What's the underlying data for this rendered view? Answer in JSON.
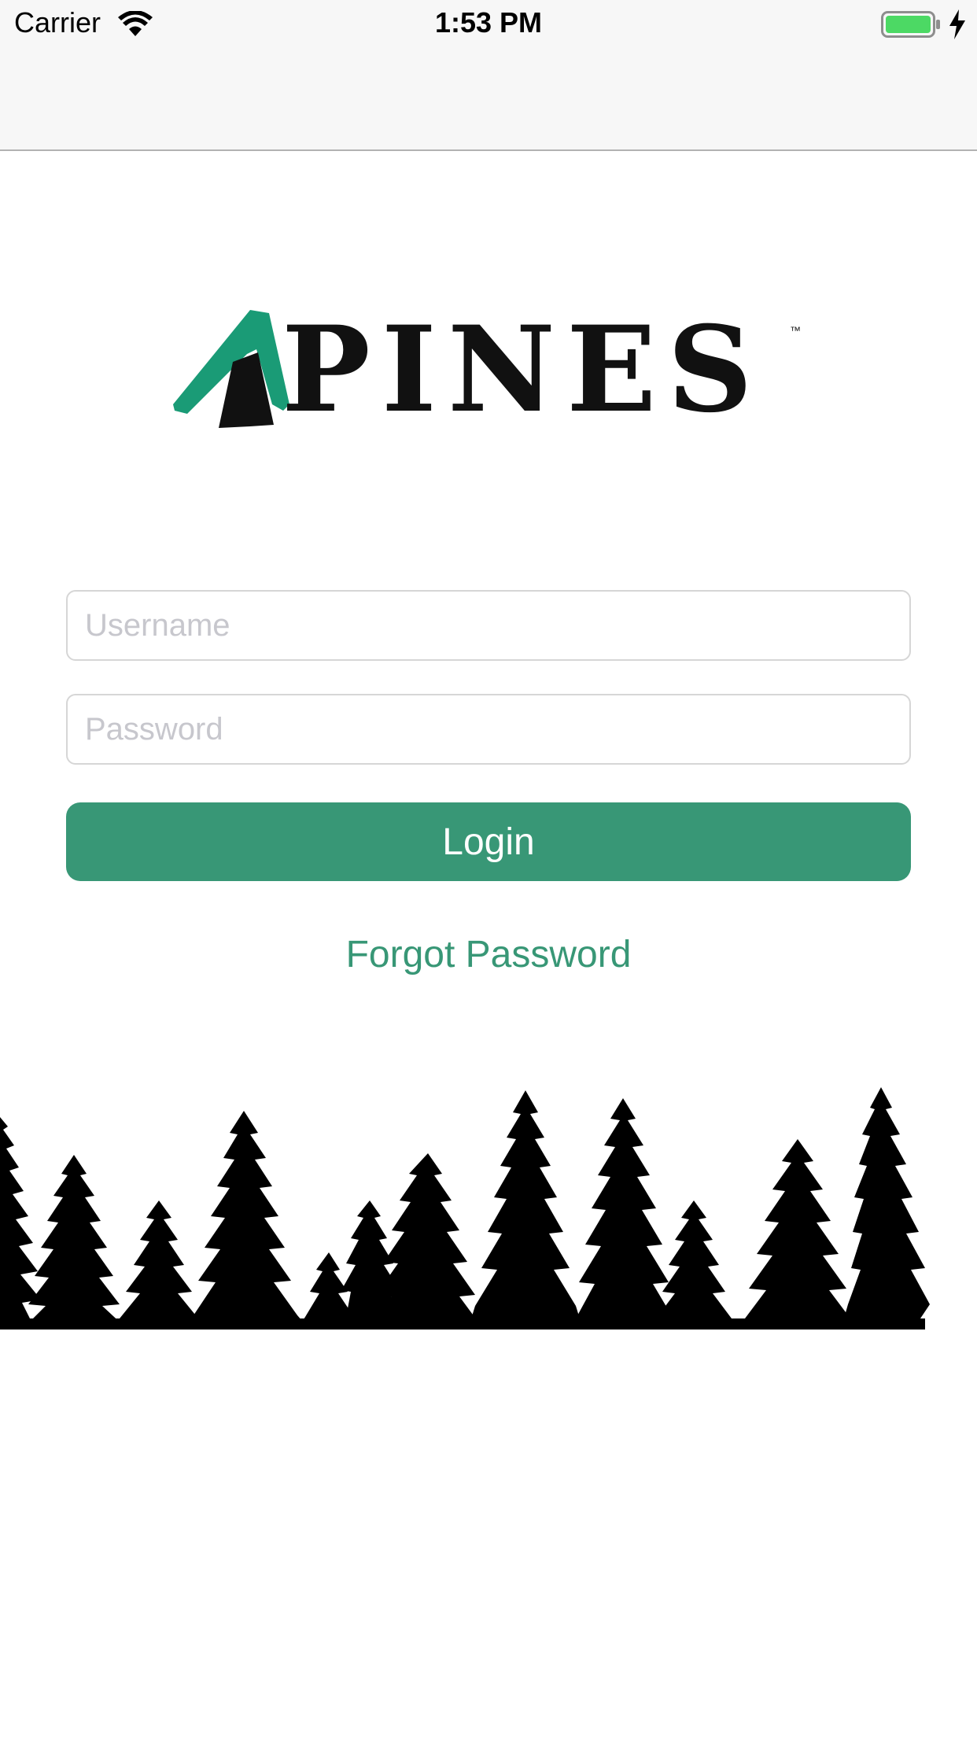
{
  "status_bar": {
    "carrier": "Carrier",
    "time": "1:53 PM",
    "wifi_icon": "wifi-icon",
    "battery_icon": "battery-charging-icon",
    "battery_color": "#4cd964"
  },
  "logo": {
    "text": "PINES",
    "tm": "™",
    "accent_color": "#1a9b76"
  },
  "form": {
    "username_placeholder": "Username",
    "username_value": "",
    "password_placeholder": "Password",
    "password_value": "",
    "login_label": "Login",
    "forgot_label": "Forgot Password"
  },
  "colors": {
    "brand": "#389776",
    "nav_background": "#f7f7f7"
  },
  "footer": {
    "illustration": "pine-trees-silhouette"
  }
}
